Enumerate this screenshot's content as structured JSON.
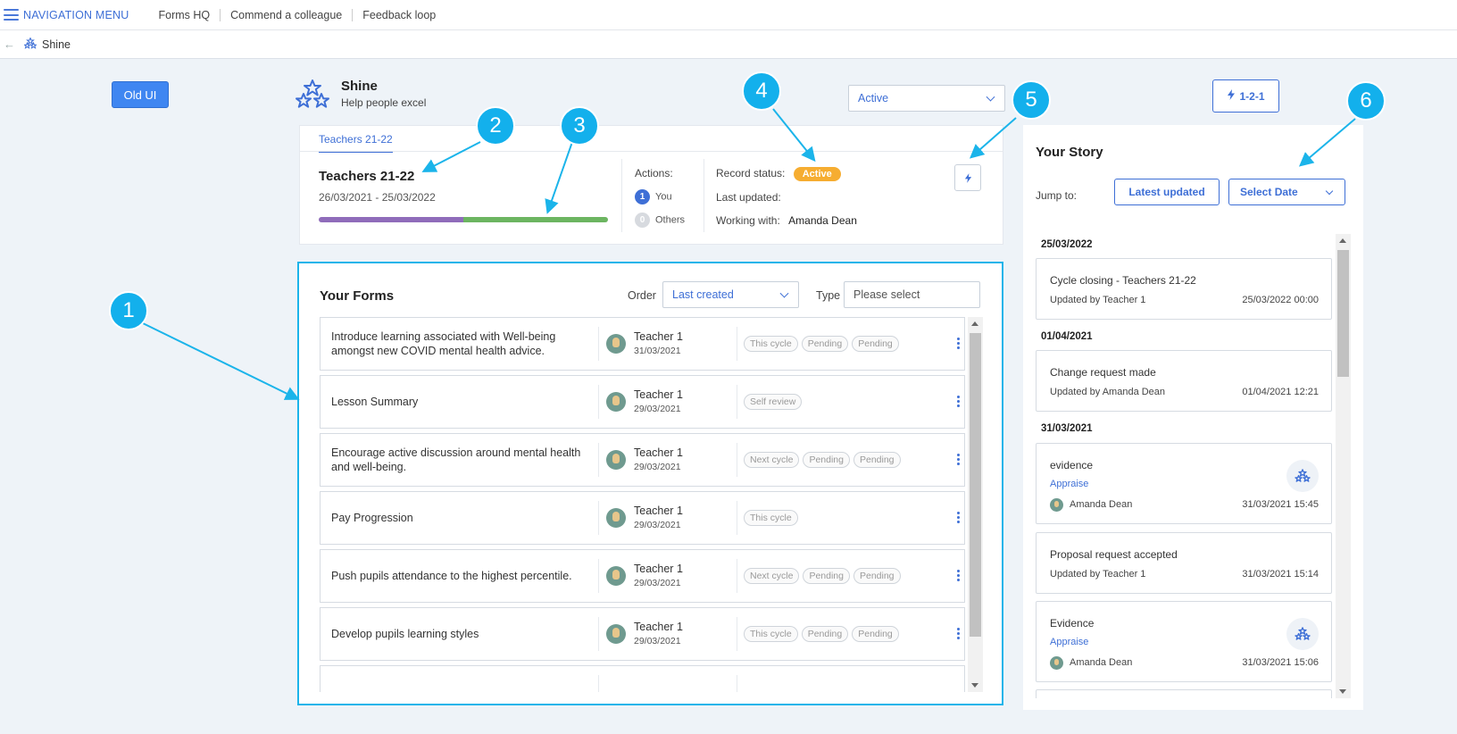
{
  "topnav": {
    "menu": "NAVIGATION MENU",
    "links": [
      "Forms HQ",
      "Commend a colleague",
      "Feedback loop"
    ]
  },
  "breadcrumb": {
    "label": "Shine"
  },
  "old_ui_button": "Old UI",
  "app": {
    "title": "Shine",
    "subtitle": "Help people excel"
  },
  "status_select": "Active",
  "one_to_one_button": "1-2-1",
  "cycle": {
    "tab": "Teachers 21-22",
    "name": "Teachers 21-22",
    "dates": "26/03/2021 - 25/03/2022",
    "progress": 0.5,
    "progress_colors": [
      "#8f6cba",
      "#6cb561"
    ],
    "actions_label": "Actions:",
    "you_count": "1",
    "you_label": "You",
    "others_count": "0",
    "others_label": "Others",
    "record_status_label": "Record status:",
    "record_status": "Active",
    "last_updated_label": "Last updated:",
    "working_with_label": "Working with:",
    "working_with": "Amanda Dean"
  },
  "forms": {
    "title": "Your Forms",
    "order_label": "Order",
    "order_value": "Last created",
    "type_label": "Type",
    "type_placeholder": "Please select",
    "rows": [
      {
        "title": "Introduce learning associated with Well-being amongst new COVID mental health advice.",
        "owner": "Teacher 1",
        "date": "31/03/2021",
        "tags": [
          "This cycle",
          "Pending",
          "Pending"
        ]
      },
      {
        "title": "Lesson Summary",
        "owner": "Teacher 1",
        "date": "29/03/2021",
        "tags": [
          "Self review"
        ]
      },
      {
        "title": "Encourage active discussion around mental health and well-being.",
        "owner": "Teacher 1",
        "date": "29/03/2021",
        "tags": [
          "Next cycle",
          "Pending",
          "Pending"
        ]
      },
      {
        "title": "Pay Progression",
        "owner": "Teacher 1",
        "date": "29/03/2021",
        "tags": [
          "This cycle"
        ]
      },
      {
        "title": "Push pupils attendance to the highest percentile.",
        "owner": "Teacher 1",
        "date": "29/03/2021",
        "tags": [
          "Next cycle",
          "Pending",
          "Pending"
        ]
      },
      {
        "title": "Develop pupils learning styles",
        "owner": "Teacher 1",
        "date": "29/03/2021",
        "tags": [
          "This cycle",
          "Pending",
          "Pending"
        ]
      }
    ]
  },
  "story": {
    "title": "Your Story",
    "jump_label": "Jump to:",
    "latest_button": "Latest updated",
    "date_select": "Select Date",
    "groups": [
      {
        "date": "25/03/2022",
        "items": [
          {
            "title": "Cycle closing - Teachers 21-22",
            "by": "Updated by Teacher 1",
            "when": "25/03/2022 00:00"
          }
        ]
      },
      {
        "date": "01/04/2021",
        "items": [
          {
            "title": "Change request made",
            "by": "Updated by Amanda Dean",
            "when": "01/04/2021 12:21"
          }
        ]
      },
      {
        "date": "31/03/2021",
        "items": [
          {
            "title": "evidence",
            "link": "Appraise",
            "by": "Amanda Dean",
            "when": "31/03/2021 15:45"
          },
          {
            "title": "Proposal request accepted",
            "by": "Updated by Teacher 1",
            "when": "31/03/2021 15:14"
          },
          {
            "title": "Evidence",
            "link": "Appraise",
            "by": "Amanda Dean",
            "when": "31/03/2021 15:06"
          }
        ]
      }
    ]
  },
  "callouts": [
    "1",
    "2",
    "3",
    "4",
    "5",
    "6"
  ],
  "colors": {
    "accent": "#3e6fd6",
    "callout": "#13b0ec",
    "active_badge": "#f6ad31",
    "old_ui": "#3f86f1"
  }
}
